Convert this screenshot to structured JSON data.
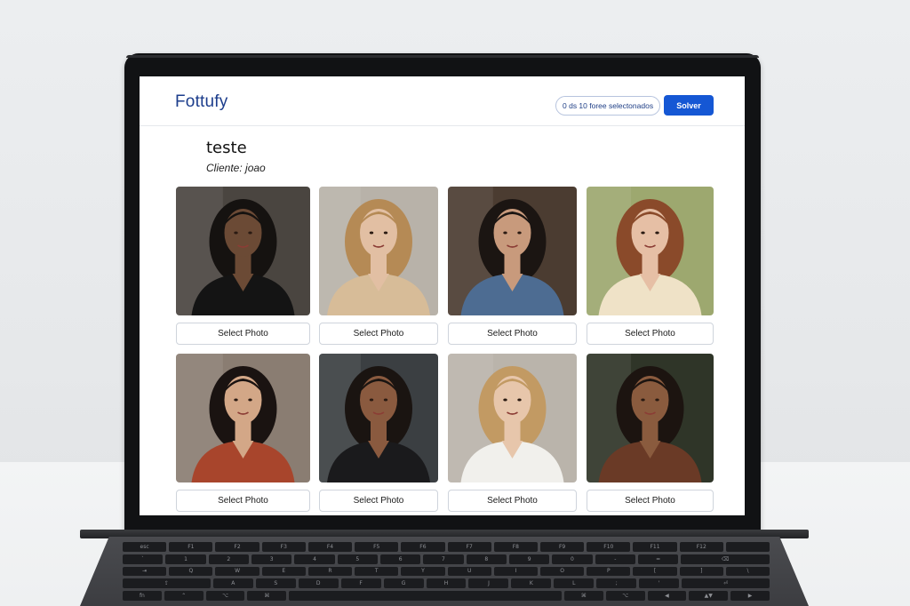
{
  "app": {
    "logo": "Fottufy",
    "selection_counter": "0 ds 10 foree selectonados",
    "solver_button": "Solver"
  },
  "gallery": {
    "title": "teste",
    "client": "Cliente: joao",
    "photos": [
      {
        "button": "Select Photo",
        "bg": "#4a4540",
        "hair": "#151210",
        "skin": "#6b4a35",
        "top": "#141414"
      },
      {
        "button": "Select Photo",
        "bg": "#b8b2a9",
        "hair": "#b58a55",
        "skin": "#e2bfa3",
        "top": "#d7bc98"
      },
      {
        "button": "Select Photo",
        "bg": "#4b3c31",
        "hair": "#1b1512",
        "skin": "#c89a7c",
        "top": "#4d6c92"
      },
      {
        "button": "Select Photo",
        "bg": "#9da86f",
        "hair": "#8a4a2a",
        "skin": "#e6bfa5",
        "top": "#efe2c7"
      },
      {
        "button": "Select Photo",
        "bg": "#8a7d72",
        "hair": "#1a1311",
        "skin": "#d3a787",
        "top": "#a8452c"
      },
      {
        "button": "Select Photo",
        "bg": "#3b3f42",
        "hair": "#1a1411",
        "skin": "#8a5a3f",
        "top": "#1a1a1c"
      },
      {
        "button": "Select Photo",
        "bg": "#bab4ab",
        "hair": "#c29a63",
        "skin": "#e7c6ab",
        "top": "#f1f0ec"
      },
      {
        "button": "Select Photo",
        "bg": "#2f3528",
        "hair": "#1c1410",
        "skin": "#8a5b3e",
        "top": "#6a3a26"
      }
    ]
  },
  "keyboard": {
    "rows": [
      [
        "esc",
        "F1",
        "F2",
        "F3",
        "F4",
        "F5",
        "F6",
        "F7",
        "F8",
        "F9",
        "F10",
        "F11",
        "F12",
        ""
      ],
      [
        "`",
        "1",
        "2",
        "3",
        "4",
        "5",
        "6",
        "7",
        "8",
        "9",
        "0",
        "-",
        "=",
        "⌫"
      ],
      [
        "⇥",
        "Q",
        "W",
        "E",
        "R",
        "T",
        "Y",
        "U",
        "I",
        "O",
        "P",
        "[",
        "]",
        "\\"
      ],
      [
        "⇪",
        "A",
        "S",
        "D",
        "F",
        "G",
        "H",
        "J",
        "K",
        "L",
        ";",
        "'",
        "⏎"
      ],
      [
        "fn",
        "⌃",
        "⌥",
        "⌘",
        "",
        "⌘",
        "⌥",
        "◀",
        "▲▼",
        "▶"
      ]
    ]
  }
}
